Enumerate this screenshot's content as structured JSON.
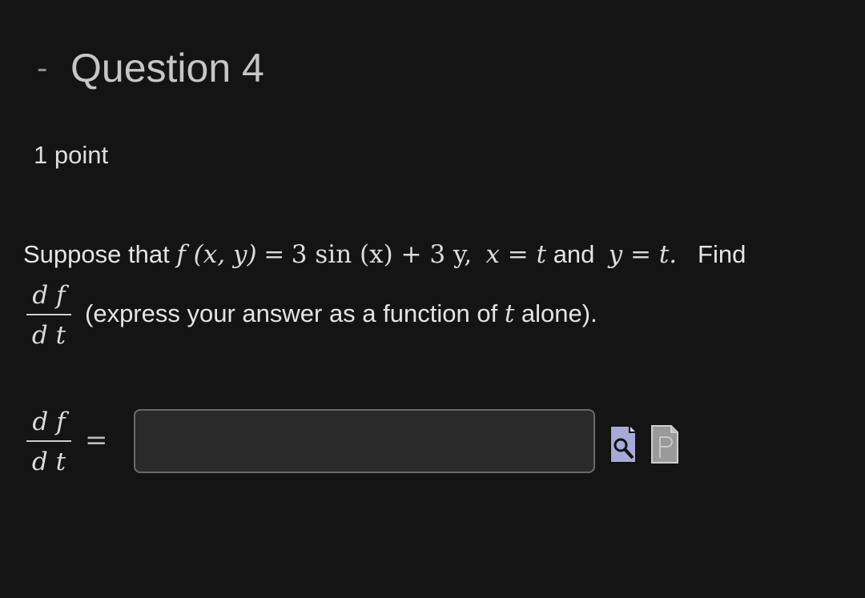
{
  "question": {
    "toggle": "-",
    "title": "Question 4",
    "points": "1 point"
  },
  "prompt": {
    "lead": "Suppose that",
    "f_of": "f (x, y)",
    "equals": "=",
    "expr": "3 sin (x) + 3 y,",
    "x_eq": "x = t",
    "and": "and",
    "y_eq": "y = t.",
    "find": "Find",
    "frac_num": "d f",
    "frac_den": "d t",
    "rest_pre": "(express your answer as a function of",
    "rest_var": "t",
    "rest_post": "alone)."
  },
  "answer": {
    "frac_num": "d f",
    "frac_den": "d t",
    "equals": "=",
    "value": "",
    "placeholder": ""
  },
  "icons": [
    "preview-answer-icon",
    "equation-editor-icon"
  ],
  "colors": {
    "background": "#141414",
    "input_bg": "#2a2a2a",
    "input_border": "#6a6a6a",
    "preview_icon": "#a9a9d8",
    "editor_icon": "#9a9a9a"
  }
}
